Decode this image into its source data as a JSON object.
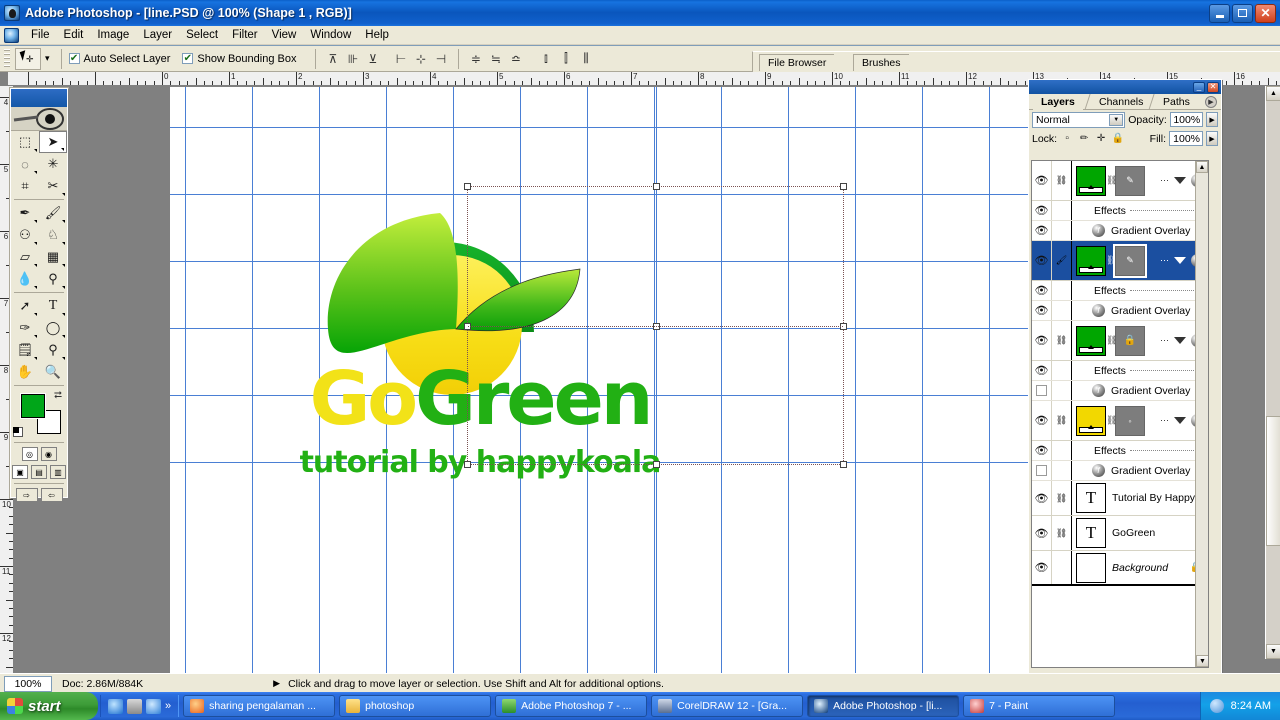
{
  "window": {
    "title": "Adobe Photoshop - [line.PSD @ 100% (Shape 1 , RGB)]",
    "minimize": "_",
    "maximize": "□",
    "close": "✕"
  },
  "menu": [
    "File",
    "Edit",
    "Image",
    "Layer",
    "Select",
    "Filter",
    "View",
    "Window",
    "Help"
  ],
  "options_bar": {
    "tool_icon": "move-tool",
    "auto_select_layer": {
      "label": "Auto Select Layer",
      "checked": true,
      "mark": "✔"
    },
    "show_bounding_box": {
      "label": "Show Bounding Box",
      "checked": true,
      "mark": "✔"
    },
    "align_buttons": [
      "⊤",
      "⊣",
      "⊥",
      "⊢",
      "⊦",
      "⊧"
    ],
    "distribute_buttons": [
      "≡",
      "≣",
      "≡",
      "⫼",
      "⫿",
      "⫼"
    ]
  },
  "palette_well": {
    "tabs": [
      "File Browser",
      "Brushes"
    ]
  },
  "toolbox": {
    "tools": [
      "rectangular-marquee",
      "move",
      "lasso",
      "magic-wand",
      "crop",
      "slice",
      "healing-brush",
      "brush",
      "clone-stamp",
      "history-brush",
      "eraser",
      "gradient",
      "blur",
      "dodge",
      "path-selection",
      "type",
      "pen",
      "ellipse-shape",
      "notes",
      "eyedropper",
      "hand",
      "zoom"
    ],
    "foreground_color": "#00a619",
    "background_color": "#ffffff",
    "selected_tool": "move"
  },
  "rulers": {
    "units": "inches",
    "horizontal_labels": [
      "0",
      "1",
      "2",
      "3",
      "4",
      "5",
      "6",
      "7",
      "8",
      "9",
      "10",
      "11",
      "12",
      "13",
      "14",
      "15",
      "16"
    ],
    "vertical_labels": [
      "4",
      "5",
      "6",
      "7",
      "8",
      "9",
      "10",
      "11",
      "12"
    ]
  },
  "canvas": {
    "logo": {
      "word_go": "Go",
      "word_green": "Green",
      "go_color": "#f2e218",
      "green_color": "#22b014",
      "tagline": "tutorial by happykoala",
      "tagline_color": "#22b014",
      "arc_color": "#18a81c",
      "leaf_gradient_top": "#b4e83a",
      "leaf_gradient_bottom": "#0ba30b",
      "circle_color": "#f5e51e"
    }
  },
  "layers_panel": {
    "tabs": [
      "Layers",
      "Channels",
      "Paths"
    ],
    "blend_mode": "Normal",
    "opacity_label": "Opacity:",
    "opacity_value": "100%",
    "lock_label": "Lock:",
    "lock_icons": [
      "transparency-lock",
      "image-lock",
      "position-lock",
      "all-lock"
    ],
    "fill_label": "Fill:",
    "fill_value": "100%",
    "effects_label": "Effects",
    "effect_name": "Gradient Overlay",
    "layers": [
      {
        "kind": "shape",
        "thumb_color": "#00a600",
        "mask": "vector",
        "selected": false,
        "effects": [
          "Gradient Overlay"
        ],
        "linked": true,
        "visible": true
      },
      {
        "kind": "shape",
        "thumb_color": "#00a600",
        "mask": "vector",
        "selected": true,
        "effects": [
          "Gradient Overlay"
        ],
        "linked": false,
        "visible": true
      },
      {
        "kind": "shape",
        "thumb_color": "#00a600",
        "mask": "locked",
        "selected": false,
        "effects": [
          "Gradient Overlay"
        ],
        "linked": true,
        "visible": true
      },
      {
        "kind": "shape",
        "thumb_color": "#f2d800",
        "mask": "vector",
        "selected": false,
        "effects": [
          "Gradient Overlay"
        ],
        "linked": true,
        "visible": true
      },
      {
        "kind": "text",
        "name": "Tutorial By Happy...",
        "selected": false,
        "linked": true,
        "visible": true
      },
      {
        "kind": "text",
        "name": "GoGreen",
        "selected": false,
        "linked": true,
        "visible": true
      },
      {
        "kind": "background",
        "name": "Background",
        "selected": false,
        "locked": true,
        "visible": true
      }
    ],
    "bottom_buttons": [
      "layer-style",
      "layer-mask",
      "new-group",
      "new-fill-adjustment",
      "new-layer",
      "delete-layer"
    ]
  },
  "status_bar": {
    "zoom": "100%",
    "doc_info": "Doc: 2.86M/884K",
    "hint": "Click and drag to move layer or selection.  Use Shift and Alt for additional options."
  },
  "taskbar": {
    "start_label": "start",
    "quick_launch": [
      "internet-explorer-icon",
      "show-desktop-icon",
      "media-player-icon",
      "chevron-double-icon"
    ],
    "items": [
      {
        "label": "sharing pengalaman ...",
        "icon": "firefox-icon",
        "active": false
      },
      {
        "label": "photoshop",
        "icon": "folder-icon",
        "active": false
      },
      {
        "label": "Adobe Photoshop 7 - ...",
        "icon": "photoshop7-icon",
        "active": false
      },
      {
        "label": "CorelDRAW 12 - [Gra...",
        "icon": "coreldraw-icon",
        "active": false
      },
      {
        "label": "Adobe Photoshop - [li...",
        "icon": "photoshop-icon",
        "active": true
      },
      {
        "label": "7 - Paint",
        "icon": "paint-icon",
        "active": false
      }
    ],
    "clock": "8:24 AM"
  }
}
